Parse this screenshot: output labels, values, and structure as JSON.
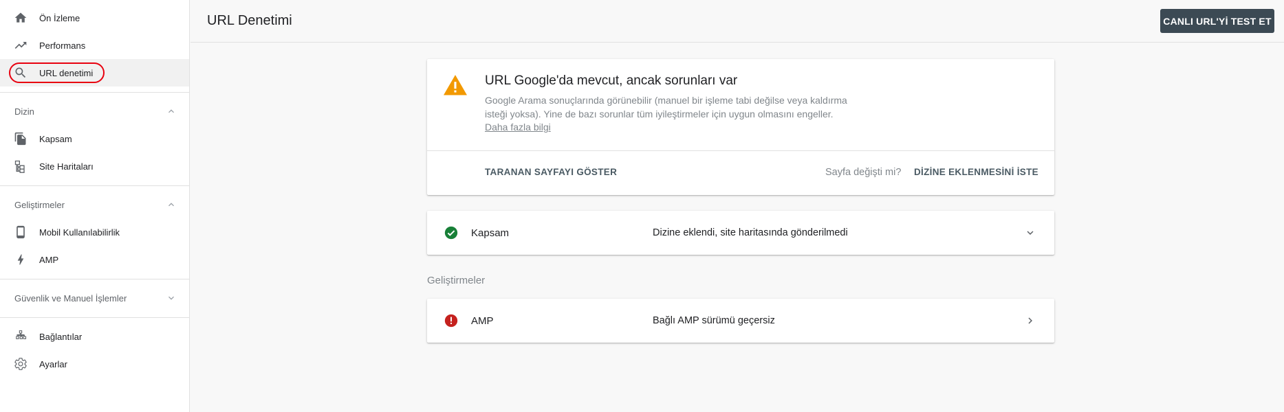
{
  "sidebar": {
    "items": [
      {
        "label": "Ön İzleme",
        "icon": "home-icon"
      },
      {
        "label": "Performans",
        "icon": "trending-up-icon"
      },
      {
        "label": "URL denetimi",
        "icon": "search-icon",
        "active": true
      }
    ],
    "sections": [
      {
        "label": "Dizin",
        "expanded": true,
        "items": [
          {
            "label": "Kapsam",
            "icon": "copy-icon"
          },
          {
            "label": "Site Haritaları",
            "icon": "sitemap-icon"
          }
        ]
      },
      {
        "label": "Geliştirmeler",
        "expanded": true,
        "items": [
          {
            "label": "Mobil Kullanılabilirlik",
            "icon": "phone-icon"
          },
          {
            "label": "AMP",
            "icon": "bolt-icon"
          }
        ]
      },
      {
        "label": "Güvenlik ve Manuel İşlemler",
        "expanded": false,
        "items": []
      }
    ],
    "bottom_items": [
      {
        "label": "Bağlantılar",
        "icon": "links-icon"
      },
      {
        "label": "Ayarlar",
        "icon": "gear-icon"
      }
    ]
  },
  "header": {
    "title": "URL Denetimi",
    "live_test_label": "CANLI URL'Yİ TEST ET"
  },
  "status": {
    "title": "URL Google'da mevcut, ancak sorunları var",
    "description": "Google Arama sonuçlarında görünebilir (manuel bir işleme tabi değilse veya kaldırma isteği yoksa). Yine de bazı sorunlar tüm iyileştirmeler için uygun olmasını engeller.",
    "learn_more": "Daha fazla bilgi",
    "crawled_page_label": "TARANAN SAYFAYI GÖSTER",
    "page_changed_question": "Sayfa değişti mi?",
    "request_indexing_label": "DİZİNE EKLENMESİNİ İSTE",
    "icon": "warning-icon",
    "warning_color": "#f29900"
  },
  "coverage": {
    "label": "Kapsam",
    "value": "Dizine eklendi, site haritasında gönderilmedi",
    "icon": "check-circle-icon",
    "color": "#188038"
  },
  "enhancements": {
    "label": "Geliştirmeler",
    "amp": {
      "label": "AMP",
      "value": "Bağlı AMP sürümü geçersiz",
      "icon": "error-icon",
      "color": "#c5221f"
    }
  }
}
